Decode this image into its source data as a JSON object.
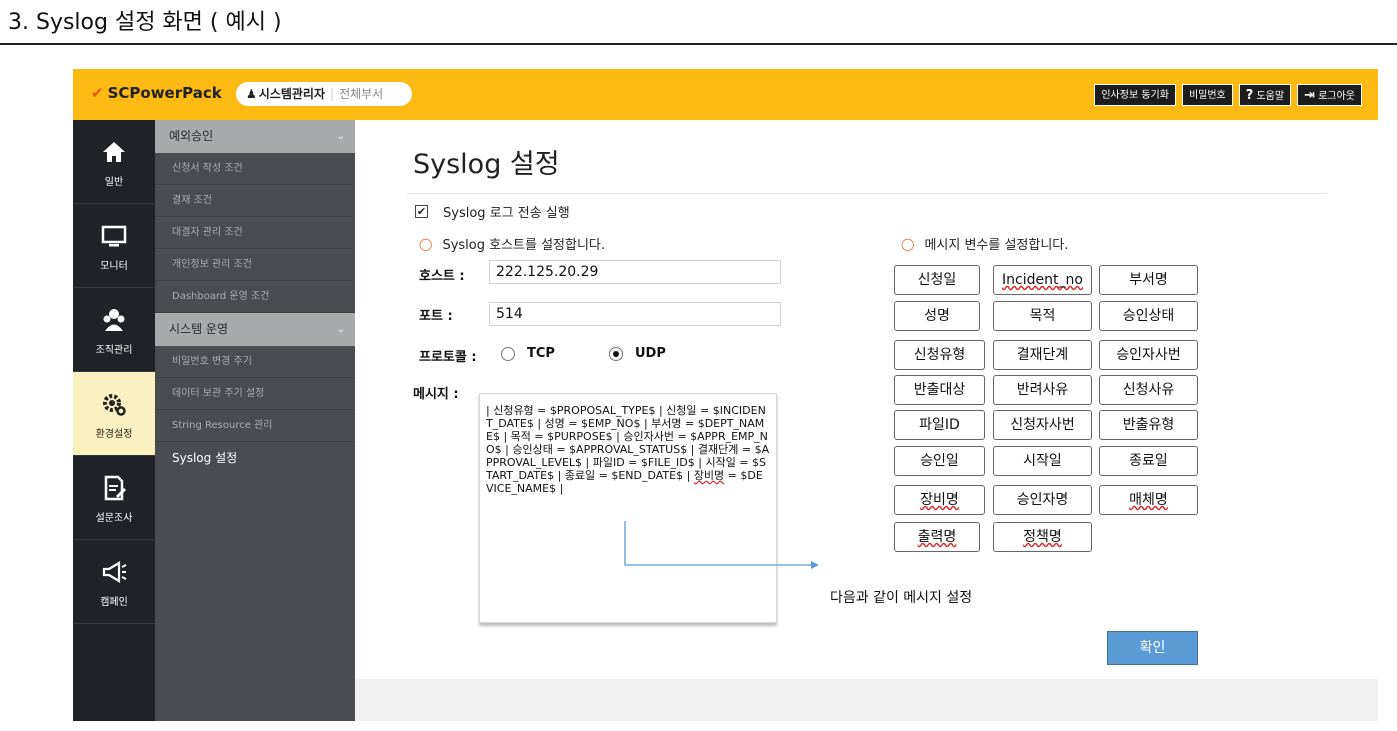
{
  "doc": {
    "heading": "3. Syslog 설정 화면 ( 예시 )"
  },
  "header": {
    "logo": "SCPowerPack",
    "user_name": "시스템관리자",
    "user_dept": "전체부서",
    "actions": [
      "인사정보 동기화",
      "비밀번호",
      "도움말",
      "로그아웃"
    ],
    "brand_color": "#fcba12"
  },
  "rail": {
    "items": [
      {
        "label": "일반",
        "icon": "home-icon"
      },
      {
        "label": "모니터",
        "icon": "monitor-icon"
      },
      {
        "label": "조직관리",
        "icon": "users-icon"
      },
      {
        "label": "환경설정",
        "icon": "gear-icon"
      },
      {
        "label": "설문조사",
        "icon": "survey-icon"
      },
      {
        "label": "캠페인",
        "icon": "megaphone-icon"
      }
    ]
  },
  "submenu": {
    "group1": "예외승인",
    "group1_items": [
      "신청서 작성 조건",
      "결재 조건",
      "대결자 관리 조건",
      "개인정보 관리 조건",
      "Dashboard 운영 조건"
    ],
    "group2": "시스템 운영",
    "group2_items": [
      "비밀번호 변경 주기",
      "데이터 보관 주기 설정",
      "String Resource 관리",
      "Syslog 설정"
    ]
  },
  "main": {
    "title": "Syslog 설정",
    "enable_label": "Syslog 로그 전송 실행",
    "host_section": "Syslog 호스트를 설정합니다.",
    "var_section": "메시지 변수를 설정합니다.",
    "host_label": "호스트 :",
    "host_value": "222.125.20.29",
    "port_label": "포트 :",
    "port_value": "514",
    "protocol_label": "프로토콜 :",
    "protocol_tcp": "TCP",
    "protocol_udp": "UDP",
    "protocol_selected": "UDP",
    "message_label": "메시지 :",
    "message_text": "| 신청유형 = $PROPOSAL_TYPE$ | 신청일 = $INCIDENT_DATE$ | 성명 = $EMP_NO$ | 부서명 = $DEPT_NAME$ | 목적 = $PURPOSE$ | 승인자사번 = $APPR_EMP_NO$ | 승인상태 = $APPROVAL_STATUS$ | 결재단계 = $APPROVAL_LEVEL$ | 파일ID = $FILE_ID$ | 시작일 = $START_DATE$ | 종료일 = $END_DATE$ |",
    "message_tail_underlined": "장비명",
    "message_tail_rest": " = $DEVICE_NAME$ |",
    "callout": "다음과 같이 메시지 설정",
    "variables": [
      "신청일",
      "Incident_no",
      "부서명",
      "성명",
      "목적",
      "승인상태",
      "신청유형",
      "결재단계",
      "승인자사번",
      "반출대상",
      "반려사유",
      "신청사유",
      "파일ID",
      "신청자사번",
      "반출유형",
      "승인일",
      "시작일",
      "종료일",
      "장비명",
      "승인자명",
      "매체명",
      "출력명",
      "정책명"
    ],
    "ok_label": "확인"
  }
}
